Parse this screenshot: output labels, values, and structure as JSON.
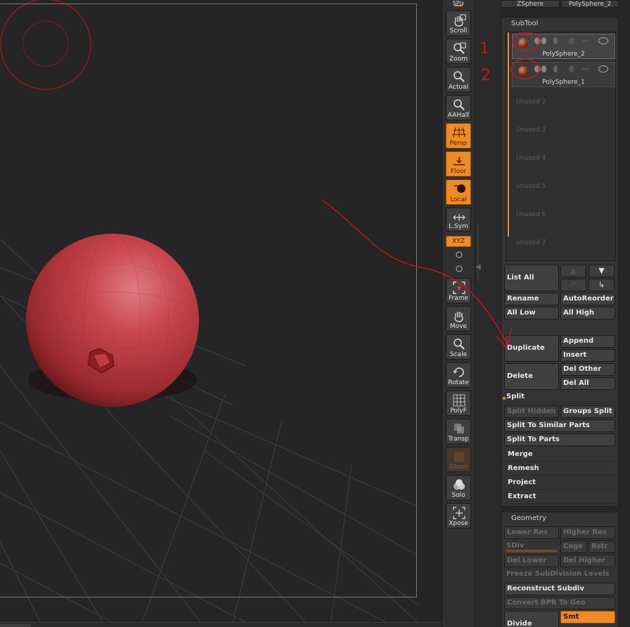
{
  "shelf": {
    "top_label": "SPix",
    "buttons": [
      {
        "key": "scroll",
        "label": "Scroll",
        "state": "normal"
      },
      {
        "key": "zoom",
        "label": "Zoom",
        "state": "normal"
      },
      {
        "key": "actual",
        "label": "Actual",
        "state": "normal"
      },
      {
        "key": "aahalf",
        "label": "AAHalf",
        "state": "normal"
      },
      {
        "key": "persp",
        "label": "Persp",
        "state": "on"
      },
      {
        "key": "floor",
        "label": "Floor",
        "state": "on"
      },
      {
        "key": "local",
        "label": "Local",
        "state": "on"
      },
      {
        "key": "lsym",
        "label": "L.Sym",
        "state": "normal"
      },
      {
        "key": "frame",
        "label": "Frame",
        "state": "normal"
      },
      {
        "key": "move",
        "label": "Move",
        "state": "normal"
      },
      {
        "key": "scale",
        "label": "Scale",
        "state": "normal"
      },
      {
        "key": "rotate",
        "label": "Rotate",
        "state": "normal"
      },
      {
        "key": "polyf",
        "label": "PolyF",
        "state": "normal"
      },
      {
        "key": "transp",
        "label": "Transp",
        "state": "normal"
      },
      {
        "key": "ghost",
        "label": "Ghost",
        "state": "disabled"
      },
      {
        "key": "solo",
        "label": "Solo",
        "state": "normal"
      },
      {
        "key": "xpose",
        "label": "Xpose",
        "state": "normal"
      }
    ],
    "xyz_label": "XYZ"
  },
  "tool_chips": {
    "left": "ZSphere",
    "right": "PolySphere_2"
  },
  "subtool": {
    "title": "SubTool",
    "items": [
      {
        "name": "PolySphere_2",
        "selected": true
      },
      {
        "name": "PolySphere_1",
        "selected": false
      }
    ],
    "unused": [
      "Unused 2",
      "Unused 3",
      "Unused 4",
      "Unused 5",
      "Unused 6",
      "Unused 7"
    ],
    "list_all": "List All",
    "rename": "Rename",
    "autoreorder": "AutoReorder",
    "all_low": "All Low",
    "all_high": "All High",
    "duplicate": "Duplicate",
    "append": "Append",
    "insert": "Insert",
    "delete": "Delete",
    "del_other": "Del Other",
    "del_all": "Del All",
    "split": "Split",
    "split_hidden": "Split Hidden",
    "groups_split": "Groups Split",
    "split_similar": "Split To Similar Parts",
    "split_parts": "Split To Parts",
    "merge": "Merge",
    "remesh": "Remesh",
    "project": "Project",
    "extract": "Extract"
  },
  "geometry": {
    "title": "Geometry",
    "lower_res": "Lower Res",
    "higher_res": "Higher Res",
    "sdiv": "SDiv",
    "cage": "Cage",
    "rstr": "Rstr",
    "del_lower": "Del Lower",
    "del_higher": "Del Higher",
    "freeze": "Freeze SubDivision Levels",
    "reconstruct": "Reconstruct Subdiv",
    "convert_bpr": "Convert BPR To Geo",
    "divide": "Divide",
    "smt": "Smt"
  },
  "annotations": {
    "mark_1": "1",
    "mark_2": "2"
  },
  "colors": {
    "accent": "#f08a24",
    "sphere": "#c0393f",
    "annotation": "#d21414"
  }
}
